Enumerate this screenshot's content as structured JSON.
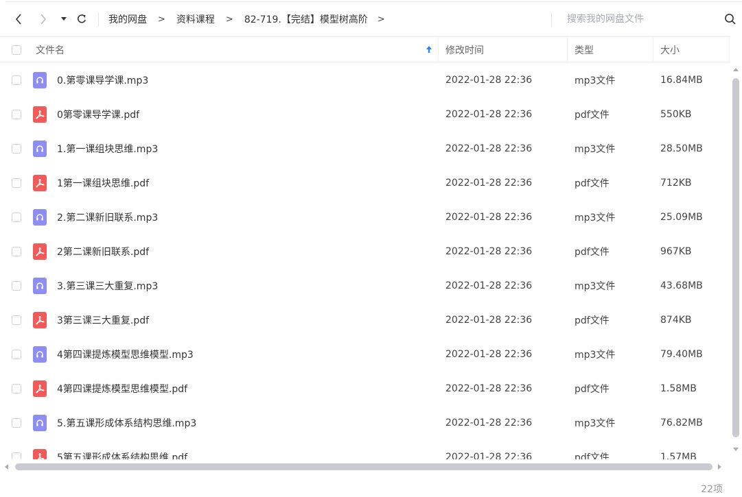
{
  "toolbar": {
    "breadcrumb": [
      "我的网盘",
      "资料课程",
      "82-719.【完结】模型树高阶"
    ],
    "breadcrumb_separator": ">",
    "search_placeholder": "搜索我的网盘文件"
  },
  "table": {
    "columns": {
      "name": "文件名",
      "modified": "修改时间",
      "type": "类型",
      "size": "大小"
    },
    "sort": {
      "column": "name",
      "direction": "ascending"
    },
    "rows": [
      {
        "name": "0.第零课导学课.mp3",
        "kind": "mp3",
        "modified": "2022-01-28 22:36",
        "type": "mp3文件",
        "size": "16.84MB"
      },
      {
        "name": "0第零课导学课.pdf",
        "kind": "pdf",
        "modified": "2022-01-28 22:36",
        "type": "pdf文件",
        "size": "550KB"
      },
      {
        "name": "1.第一课组块思维.mp3",
        "kind": "mp3",
        "modified": "2022-01-28 22:36",
        "type": "mp3文件",
        "size": "28.50MB"
      },
      {
        "name": "1第一课组块思维.pdf",
        "kind": "pdf",
        "modified": "2022-01-28 22:36",
        "type": "pdf文件",
        "size": "712KB"
      },
      {
        "name": "2.第二课新旧联系.mp3",
        "kind": "mp3",
        "modified": "2022-01-28 22:36",
        "type": "mp3文件",
        "size": "25.09MB"
      },
      {
        "name": "2第二课新旧联系.pdf",
        "kind": "pdf",
        "modified": "2022-01-28 22:36",
        "type": "pdf文件",
        "size": "967KB"
      },
      {
        "name": "3.第三课三大重复.mp3",
        "kind": "mp3",
        "modified": "2022-01-28 22:36",
        "type": "mp3文件",
        "size": "43.68MB"
      },
      {
        "name": "3第三课三大重复.pdf",
        "kind": "pdf",
        "modified": "2022-01-28 22:36",
        "type": "pdf文件",
        "size": "874KB"
      },
      {
        "name": "4第四课提炼模型思维模型.mp3",
        "kind": "mp3",
        "modified": "2022-01-28 22:36",
        "type": "mp3文件",
        "size": "79.40MB"
      },
      {
        "name": "4第四课提炼模型思维模型.pdf",
        "kind": "pdf",
        "modified": "2022-01-28 22:36",
        "type": "pdf文件",
        "size": "1.58MB"
      },
      {
        "name": "5.第五课形成体系结构思维.mp3",
        "kind": "mp3",
        "modified": "2022-01-28 22:36",
        "type": "mp3文件",
        "size": "76.82MB"
      },
      {
        "name": "5第五课形成体系结构思维.pdf",
        "kind": "pdf",
        "modified": "2022-01-28 22:36",
        "type": "pdf文件",
        "size": "1.57MB"
      }
    ]
  },
  "status": {
    "item_count": "22项"
  },
  "colors": {
    "mp3_icon": "#8e8ef2",
    "pdf_icon": "#f25a5a",
    "sort_arrow": "#2f7ff0"
  },
  "icons": {
    "mp3": "headphones-icon",
    "pdf": "pdf-icon"
  }
}
